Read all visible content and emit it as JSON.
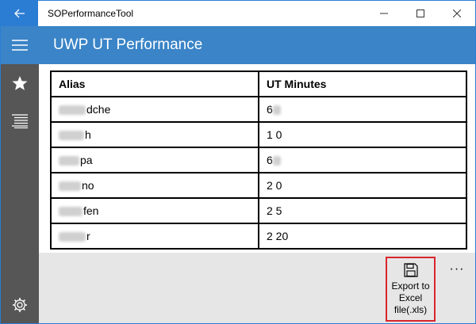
{
  "window": {
    "title": "SOPerformanceTool",
    "minimize_icon": "minimize-icon",
    "maximize_icon": "maximize-icon",
    "close_icon": "close-icon"
  },
  "nav": {
    "items": [
      {
        "icon": "hamburger-icon"
      },
      {
        "icon": "star-icon"
      },
      {
        "icon": "list-icon"
      },
      {
        "icon": "gear-icon"
      }
    ]
  },
  "header": {
    "title": "UWP UT Performance"
  },
  "table": {
    "columns": [
      "Alias",
      "UT Minutes"
    ],
    "rows": [
      [
        "dche",
        "6"
      ],
      [
        "h",
        "1 0"
      ],
      [
        "pa",
        "6"
      ],
      [
        "no",
        "2 0"
      ],
      [
        "fen",
        "2 5"
      ],
      [
        "r",
        "2 20"
      ]
    ]
  },
  "commandbar": {
    "export_label": "Export to Excel file(.xls)",
    "more_label": "···"
  },
  "colors": {
    "accent": "#3a84c7",
    "nav_bg": "#565656",
    "highlight_border": "#d9252b"
  }
}
